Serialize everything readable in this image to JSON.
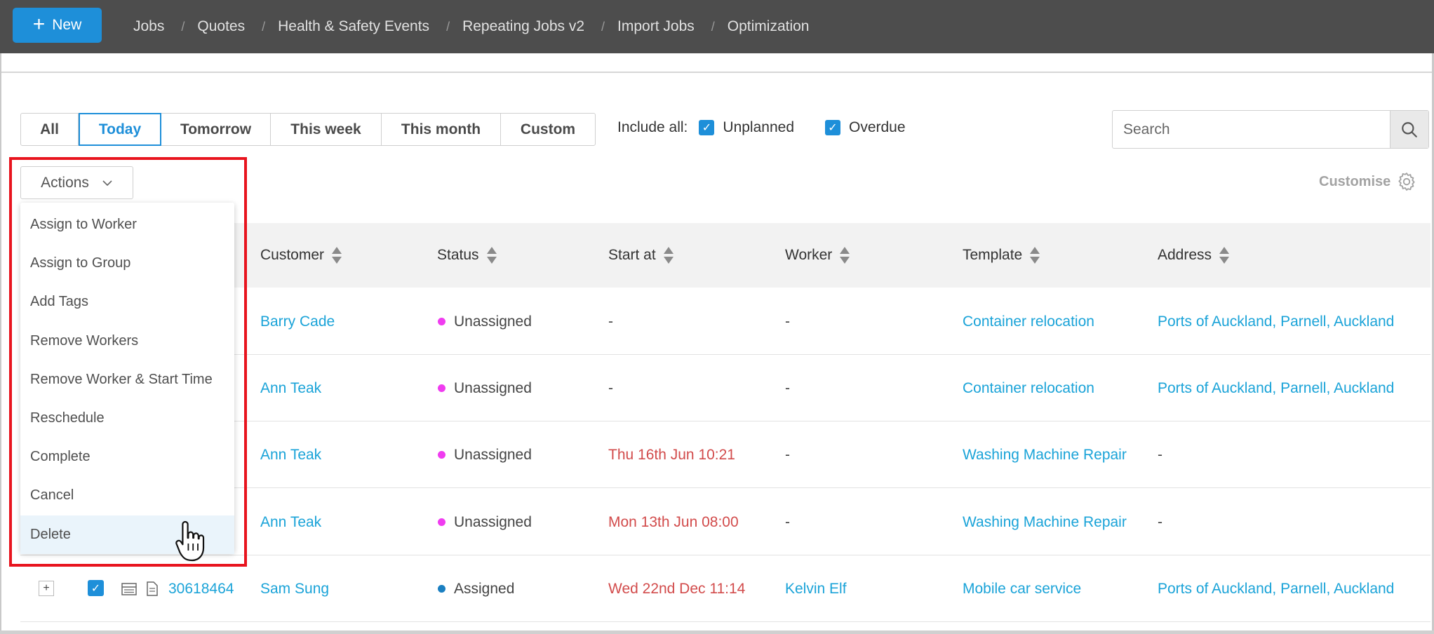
{
  "topbar": {
    "new_label": "New",
    "nav": [
      "Jobs",
      "Quotes",
      "Health & Safety Events",
      "Repeating Jobs v2",
      "Import Jobs",
      "Optimization"
    ],
    "bg_color": "#4d4d4d",
    "accent_color": "#1e8fd9"
  },
  "filters": {
    "periods": [
      "All",
      "Today",
      "Tomorrow",
      "This week",
      "This month",
      "Custom"
    ],
    "active_period": "Today",
    "include_label": "Include all:",
    "unplanned_label": "Unplanned",
    "unplanned_checked": true,
    "overdue_label": "Overdue",
    "overdue_checked": true
  },
  "search": {
    "placeholder": "Search",
    "icon": "search-icon"
  },
  "actions": {
    "label": "Actions",
    "menu": [
      "Assign to Worker",
      "Assign to Group",
      "Add Tags",
      "Remove Workers",
      "Remove Worker & Start Time",
      "Reschedule",
      "Complete",
      "Cancel",
      "Delete"
    ],
    "hovered": "Delete"
  },
  "customise_label": "Customise",
  "table": {
    "columns": [
      "Customer",
      "Status",
      "Start at",
      "Worker",
      "Template",
      "Address"
    ],
    "rows": [
      {
        "customer": "Barry Cade",
        "status": "Unassigned",
        "status_color": "#f03cf0",
        "start": "-",
        "start_overdue": false,
        "worker": "-",
        "worker_link": false,
        "template": "Container relocation",
        "address": "Ports of Auckland, Parnell, Auckland",
        "address_link": true
      },
      {
        "customer": "Ann Teak",
        "status": "Unassigned",
        "status_color": "#f03cf0",
        "start": "-",
        "start_overdue": false,
        "worker": "-",
        "worker_link": false,
        "template": "Container relocation",
        "address": "Ports of Auckland, Parnell, Auckland",
        "address_link": true
      },
      {
        "customer": "Ann Teak",
        "status": "Unassigned",
        "status_color": "#f03cf0",
        "start": "Thu 16th Jun 10:21",
        "start_overdue": true,
        "worker": "-",
        "worker_link": false,
        "template": "Washing Machine Repair",
        "address": "-",
        "address_link": false
      },
      {
        "customer": "Ann Teak",
        "status": "Unassigned",
        "status_color": "#f03cf0",
        "start": "Mon 13th Jun 08:00",
        "start_overdue": true,
        "worker": "-",
        "worker_link": false,
        "template": "Washing Machine Repair",
        "address": "-",
        "address_link": false
      },
      {
        "job_id": "30618464",
        "checked": true,
        "customer": "Sam Sung",
        "status": "Assigned",
        "status_color": "#1a7fc1",
        "start": "Wed 22nd Dec 11:14",
        "start_overdue": true,
        "worker": "Kelvin Elf",
        "worker_link": true,
        "template": "Mobile car service",
        "address": "Ports of Auckland, Parnell, Auckland",
        "address_link": true
      }
    ]
  },
  "colors": {
    "link": "#1aa3d8",
    "overdue": "#d24b4b",
    "highlight": "#e8141e"
  }
}
